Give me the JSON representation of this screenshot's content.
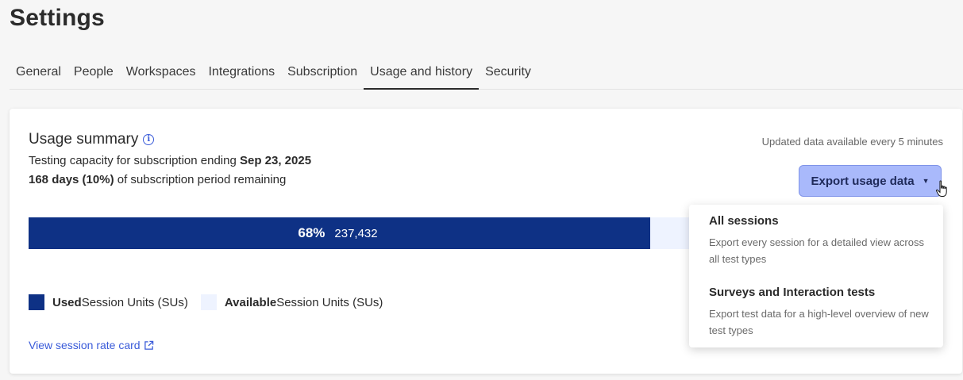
{
  "page": {
    "title": "Settings"
  },
  "tabs": [
    {
      "label": "General"
    },
    {
      "label": "People"
    },
    {
      "label": "Workspaces"
    },
    {
      "label": "Integrations"
    },
    {
      "label": "Subscription"
    },
    {
      "label": "Usage and history",
      "active": true
    },
    {
      "label": "Security"
    }
  ],
  "summary": {
    "title": "Usage summary",
    "line1_prefix": "Testing capacity for subscription ending ",
    "line1_date": "Sep 23, 2025",
    "line2_bold": "168 days (10%)",
    "line2_suffix": " of subscription period remaining",
    "updated_note": "Updated data available every 5 minutes",
    "export_label": "Export usage data"
  },
  "usage": {
    "used_percent": 68,
    "used_percent_label": "68%",
    "used_units": "237,432",
    "used_color": "#0e3185",
    "available_color": "#eef3ff"
  },
  "legend": {
    "used_bold": "Used",
    "used_text": " Session Units (SUs)",
    "available_bold": "Available",
    "available_text": " Session Units (SUs)"
  },
  "links": {
    "rate_card": "View session rate card"
  },
  "dropdown": {
    "items": [
      {
        "title": "All sessions",
        "desc": "Export every session for a detailed view across all test types"
      },
      {
        "title": "Surveys and Interaction tests",
        "desc": "Export test data for a high-level overview of new test types"
      }
    ]
  },
  "icons": {
    "info": "info-icon",
    "caret": "caret-down-icon",
    "external": "external-link-icon",
    "cursor": "hand-pointer-icon"
  },
  "colors": {
    "accent": "#3a5bd9",
    "export_button": "#a9b9fb"
  }
}
